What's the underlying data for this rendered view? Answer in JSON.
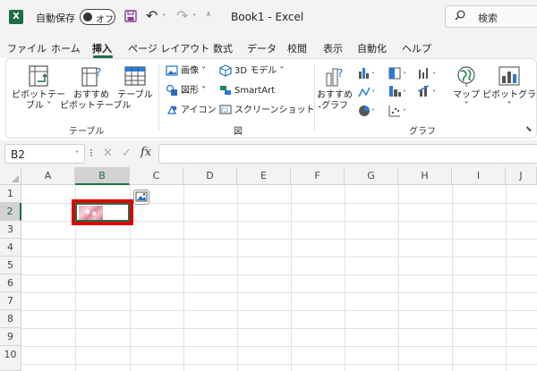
{
  "titlebar": {
    "autosave_label": "自動保存",
    "toggle_label": "オフ",
    "doc_title": "Book1  -  Excel",
    "search_label": "検索",
    "logo_letter": "X"
  },
  "tabs": [
    "ファイル",
    "ホーム",
    "挿入",
    "ページ レイアウト",
    "数式",
    "データ",
    "校閲",
    "表示",
    "自動化",
    "ヘルプ"
  ],
  "ribbon": {
    "table_group": {
      "label": "テーブル",
      "pivot_table": [
        "ピボットテー",
        "ブル ˅"
      ],
      "recommended_pivot": [
        "おすすめ",
        "ピボットテーブル"
      ],
      "table": [
        "テーブル",
        ""
      ]
    },
    "illustrations_group": {
      "label": "図",
      "image": "画像 ˅",
      "shapes": "図形 ˅",
      "icons": "アイコン",
      "model3d": "3D モデル  ˅",
      "smartart": "SmartArt",
      "screenshot": "スクリーンショット ˅"
    },
    "charts_group": {
      "label": "グラフ",
      "recommended": [
        "おすすめ",
        "グラフ"
      ],
      "maps": [
        "マップ",
        "˅"
      ],
      "pivot_chart": [
        "ピボットグラフ",
        "˅"
      ]
    }
  },
  "formula_bar": {
    "name_box": "B2",
    "fx": "fx",
    "value": ""
  },
  "grid": {
    "columns": [
      "A",
      "B",
      "C",
      "D",
      "E",
      "F",
      "G",
      "H",
      "I",
      "J"
    ],
    "rows": [
      "1",
      "2",
      "3",
      "4",
      "5",
      "6",
      "7",
      "8",
      "9",
      "10"
    ],
    "selected_column": "B",
    "selected_row": "2"
  },
  "colors": {
    "excel_green": "#1d6f42",
    "highlight_red": "#e00000"
  },
  "icons": [
    "excel-logo-icon",
    "save-icon",
    "undo-icon",
    "redo-icon",
    "search-icon",
    "pivot-table-icon",
    "recommended-pivot-icon",
    "table-icon",
    "image-icon",
    "shapes-icon",
    "icons-icon",
    "3d-model-icon",
    "smartart-icon",
    "screenshot-icon",
    "recommended-chart-icon",
    "map-icon",
    "pivot-chart-icon",
    "picture-in-cell-icon"
  ]
}
